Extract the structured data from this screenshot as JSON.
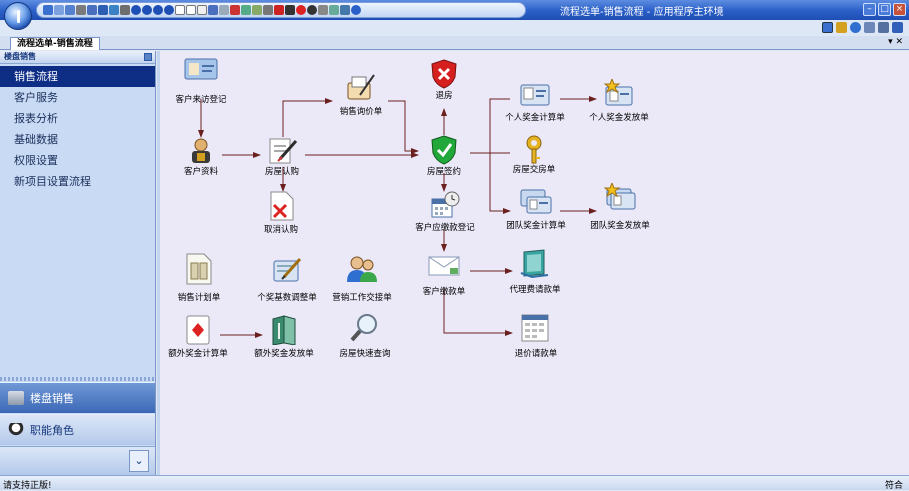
{
  "window": {
    "title": "流程选单-销售流程 - 应用程序主环境"
  },
  "tab": {
    "label": "流程选单-销售流程",
    "controls": "▾ ✕"
  },
  "sidebar": {
    "header": "楼盘销售",
    "items": [
      {
        "label": "销售流程",
        "selected": true
      },
      {
        "label": "客户服务"
      },
      {
        "label": "报表分析"
      },
      {
        "label": "基础数据"
      },
      {
        "label": "权限设置"
      },
      {
        "label": "新项目设置流程"
      }
    ],
    "categories": [
      {
        "label": "楼盘销售",
        "icon": "building-icon"
      },
      {
        "label": "职能角色",
        "icon": "person-icon"
      }
    ],
    "expand": "⌄"
  },
  "flow": {
    "nodes": [
      {
        "id": "n1",
        "label": "客户来访登记",
        "icon": "visitor-card-icon"
      },
      {
        "id": "n2",
        "label": "客户资料",
        "icon": "locked-user-icon"
      },
      {
        "id": "n3",
        "label": "房屋认购",
        "icon": "subscription-doc-icon"
      },
      {
        "id": "n4",
        "label": "取消认购",
        "icon": "cancel-doc-icon"
      },
      {
        "id": "n5",
        "label": "销售询价单",
        "icon": "quote-icon"
      },
      {
        "id": "n6",
        "label": "退房",
        "icon": "red-shield-icon"
      },
      {
        "id": "n7",
        "label": "房屋签约",
        "icon": "green-shield-icon"
      },
      {
        "id": "n8",
        "label": "客户应缴款登记",
        "icon": "calendar-clock-icon"
      },
      {
        "id": "n9",
        "label": "客户缴款单",
        "icon": "envelope-icon"
      },
      {
        "id": "n10",
        "label": "个人奖金计算单",
        "icon": "id-card-icon"
      },
      {
        "id": "n11",
        "label": "个人奖金发放单",
        "icon": "star-card-icon"
      },
      {
        "id": "n12",
        "label": "房屋交房单",
        "icon": "key-icon"
      },
      {
        "id": "n13",
        "label": "团队奖金计算单",
        "icon": "team-card-icon"
      },
      {
        "id": "n14",
        "label": "团队奖金发放单",
        "icon": "team-star-icon"
      },
      {
        "id": "n15",
        "label": "代理费请款单",
        "icon": "monitor-icon"
      },
      {
        "id": "n16",
        "label": "退价请款单",
        "icon": "calendar-doc-icon"
      },
      {
        "id": "n17",
        "label": "销售计划单",
        "icon": "plan-doc-icon"
      },
      {
        "id": "n18",
        "label": "个奖基数调整单",
        "icon": "pen-pad-icon"
      },
      {
        "id": "n19",
        "label": "营销工作交接单",
        "icon": "users-icon"
      },
      {
        "id": "n20",
        "label": "额外奖金计算单",
        "icon": "playing-card-icon"
      },
      {
        "id": "n21",
        "label": "额外奖金发放单",
        "icon": "book-icon"
      },
      {
        "id": "n22",
        "label": "房屋快速查询",
        "icon": "magnifier-icon"
      }
    ]
  },
  "status": {
    "left": "请支持正版!",
    "right": "符合"
  },
  "colors": {
    "selection": "#0e2d84",
    "canvas": "#ebe9f8",
    "arrow": "#6b2020"
  }
}
